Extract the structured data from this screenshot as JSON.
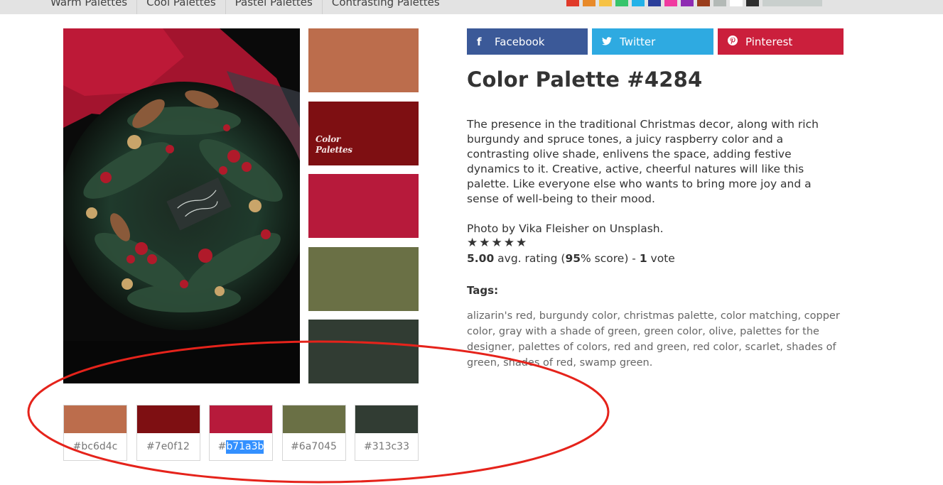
{
  "topnav": {
    "items": [
      "Warm Palettes",
      "Cool Palettes",
      "Pastel Palettes",
      "Contrasting Palettes"
    ]
  },
  "color_bar": [
    "#e03a2a",
    "#e88a2a",
    "#f6c244",
    "#36c46b",
    "#23b2e8",
    "#2b3e9a",
    "#f03aa0",
    "#8e2bb2",
    "#9a3d1c",
    "#b3b9b6",
    "#ffffff",
    "#2f2f2f",
    "#c9cfcd"
  ],
  "palette": {
    "title": "Color Palette #4284",
    "colors": [
      "#bc6d4c",
      "#7e0f12",
      "#b71a3b",
      "#6a7045",
      "#313c33"
    ],
    "hex_prefix": "#",
    "hex_values": [
      "bc6d4c",
      "7e0f12",
      "b71a3b",
      "6a7045",
      "313c33"
    ],
    "selected_index": 2,
    "logo_line1": "Color",
    "logo_line2": "Palettes"
  },
  "share": {
    "facebook": "Facebook",
    "twitter": "Twitter",
    "pinterest": "Pinterest"
  },
  "description": "The presence in the traditional Christmas decor, along with rich burgundy and spruce tones, a juicy raspberry color and a contrasting olive shade, enlivens the space, adding festive dynamics to it. Creative, active, cheerful natures will like this palette. Like everyone else who wants to bring more joy and a sense of well-being to their mood.",
  "credit": "Photo by Vika Fleisher on Unsplash.",
  "rating": {
    "stars": 5,
    "avg": "5.00",
    "avg_suffix": " avg. rating (",
    "score": "95",
    "score_suffix": "% score) - ",
    "votes": "1",
    "votes_suffix": " vote"
  },
  "tags": {
    "heading": "Tags:",
    "text": "alizarin's red, burgundy color, christmas palette, color matching, copper color, gray with a shade of green, green color, olive, palettes for the designer, palettes of colors, red and green, red color, scarlet, shades of green, shades of red, swamp green."
  }
}
